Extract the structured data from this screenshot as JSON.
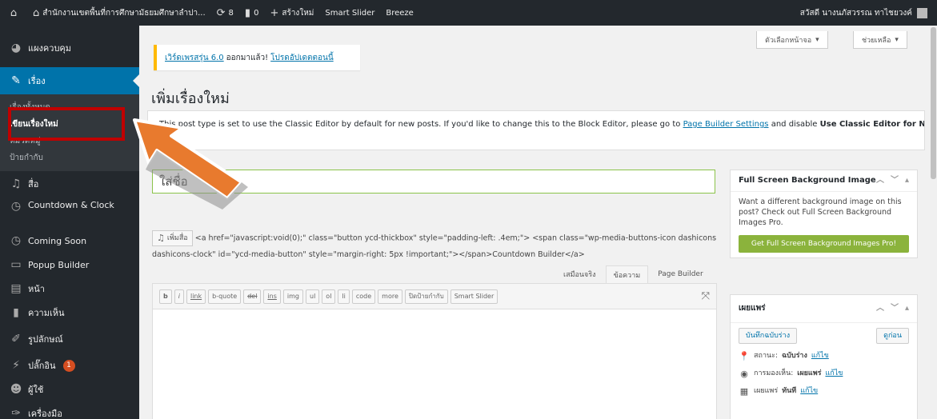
{
  "adminbar": {
    "site_name": "สำนักงานเขตพื้นที่การศึกษามัธยมศึกษาลำปา...",
    "updates_count": "8",
    "comments_count": "0",
    "new_label": "สร้างใหม่",
    "smart_slider": "Smart Slider",
    "breeze": "Breeze",
    "greeting": "สวัสดี นางนภัสวรรณ ทาไชยวงค์"
  },
  "sidebar": {
    "dashboard": "แผงควบคุม",
    "posts": "เรื่อง",
    "submenu": [
      "เรื่องทั้งหมด",
      "เขียนเรื่องใหม่",
      "หมวดหมู่",
      "ป้ายกำกับ"
    ],
    "media": "สื่อ",
    "countdown": "Countdown & Clock",
    "coming_soon": "Coming Soon",
    "popup_builder": "Popup Builder",
    "pages": "หน้า",
    "comments": "ความเห็น",
    "appearance": "รูปลักษณ์",
    "plugins": "ปลั๊กอิน",
    "plugins_badge": "1",
    "users": "ผู้ใช้",
    "tools": "เครื่องมือ"
  },
  "screen_options": "ตัวเลือกหน้าจอ",
  "help": "ช่วยเหลือ",
  "update_nag": {
    "link1": "เวิร์ดเพรสรุ่น 6.0",
    "text": "ออกมาแล้ว!",
    "link2": "โปรดอัปเดตตอนนี้"
  },
  "page_title": "เพิ่มเรื่องใหม่",
  "notice": {
    "text1": "This post type is set to use the Classic Editor by default for new posts. If you'd like to change this to the Block Editor, please go to",
    "link": "Page Builder Settings",
    "text2": "and disable",
    "bold": "Use Classic Editor for New"
  },
  "title_placeholder": "ใส่ชื่อ",
  "add_media": "เพิ่มสื่อ",
  "media_code": "<a href=\"javascript:void(0);\" class=\"button ycd-thickbox\" style=\"padding-left: .4em;\"> <span class=\"wp-media-buttons-icon dashicons dashicons-clock\" id=\"ycd-media-button\" style=\"margin-right: 5px !important;\"></span>Countdown Builder</a>",
  "editor_tabs": [
    "เสมือนจริง",
    "ข้อความ",
    "Page Builder"
  ],
  "quicktags": [
    "b",
    "i",
    "link",
    "b-quote",
    "del",
    "ins",
    "img",
    "ul",
    "ol",
    "li",
    "code",
    "more",
    "ปิดป้ายกำกับ",
    "Smart Slider"
  ],
  "fsbg": {
    "title": "Full Screen Background Image",
    "desc": "Want a different background image on this post? Check out Full Screen Background Images Pro.",
    "button": "Get Full Screen Background Images Pro!"
  },
  "publish": {
    "title": "เผยแพร่",
    "save_draft": "บันทึกฉบับร่าง",
    "preview": "ดูก่อน",
    "status_label": "สถานะ:",
    "status_value": "ฉบับร่าง",
    "visibility_label": "การมองเห็น:",
    "visibility_value": "เผยแพร่",
    "publish_label": "เผยแพร่",
    "publish_value": "ทันที",
    "edit": "แก้ไข"
  },
  "colors": {
    "adminbar": "#23282d",
    "current_menu": "#0073aa",
    "highlight_box": "#c00000",
    "arrow": "#e87a2e",
    "green_button": "#8bb33c"
  }
}
